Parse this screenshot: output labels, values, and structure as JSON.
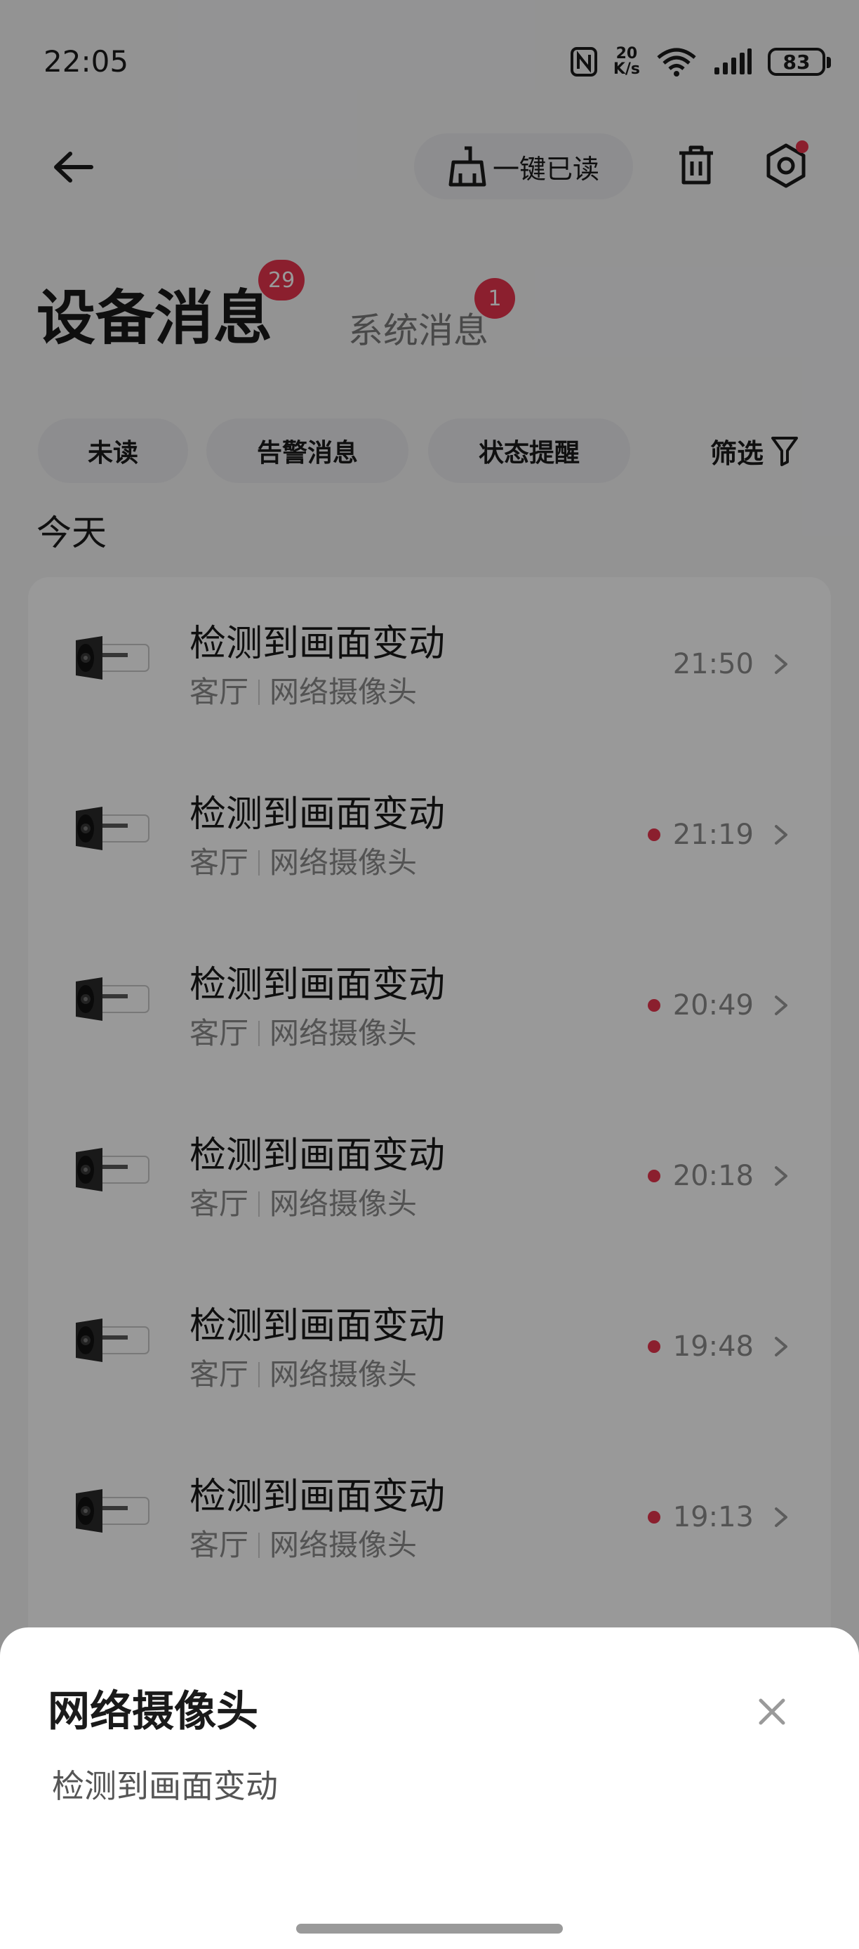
{
  "status_bar": {
    "time": "22:05",
    "net_speed_top": "20",
    "net_speed_bottom": "K/s",
    "battery": "83"
  },
  "header": {
    "read_all_label": "一键已读"
  },
  "tabs": {
    "device": {
      "label": "设备消息",
      "badge": "29"
    },
    "system": {
      "label": "系统消息",
      "badge": "1"
    }
  },
  "filters": {
    "chips": [
      "未读",
      "告警消息",
      "状态提醒"
    ],
    "filter_label": "筛选"
  },
  "section_label": "今天",
  "messages": [
    {
      "title": "检测到画面变动",
      "location": "客厅",
      "device": "网络摄像头",
      "time": "21:50",
      "unread": false
    },
    {
      "title": "检测到画面变动",
      "location": "客厅",
      "device": "网络摄像头",
      "time": "21:19",
      "unread": true
    },
    {
      "title": "检测到画面变动",
      "location": "客厅",
      "device": "网络摄像头",
      "time": "20:49",
      "unread": true
    },
    {
      "title": "检测到画面变动",
      "location": "客厅",
      "device": "网络摄像头",
      "time": "20:18",
      "unread": true
    },
    {
      "title": "检测到画面变动",
      "location": "客厅",
      "device": "网络摄像头",
      "time": "19:48",
      "unread": true
    },
    {
      "title": "检测到画面变动",
      "location": "客厅",
      "device": "网络摄像头",
      "time": "19:13",
      "unread": true
    }
  ],
  "sheet": {
    "title": "网络摄像头",
    "body": "检测到画面变动"
  },
  "colors": {
    "accent_red": "#e8344e",
    "chip_bg": "#ececee"
  }
}
